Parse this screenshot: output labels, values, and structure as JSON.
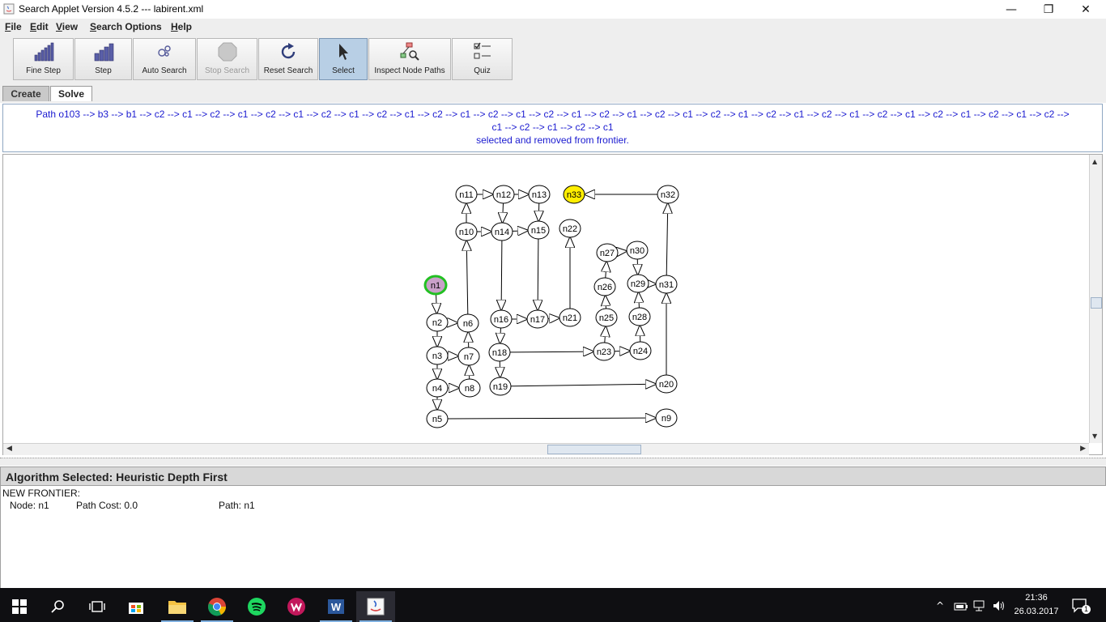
{
  "window": {
    "title": "Search Applet Version 4.5.2 --- labirent.xml",
    "minimize": "—",
    "maximize": "❐",
    "close": "✕"
  },
  "menu": {
    "items": [
      {
        "first": "F",
        "rest": "ile"
      },
      {
        "first": "E",
        "rest": "dit"
      },
      {
        "first": "V",
        "rest": "iew"
      },
      {
        "first": "S",
        "rest": "earch Options"
      },
      {
        "first": "H",
        "rest": "elp"
      }
    ]
  },
  "toolbar": {
    "buttons": [
      {
        "label": "Fine Step",
        "icon": "fine-step-icon"
      },
      {
        "label": "Step",
        "icon": "step-icon"
      },
      {
        "label": "Auto Search",
        "icon": "auto-search-icon"
      },
      {
        "label": "Stop Search",
        "icon": "stop-icon"
      },
      {
        "label": "Reset Search",
        "icon": "reset-icon"
      },
      {
        "label": "Select",
        "icon": "cursor-icon"
      },
      {
        "label": "Inspect Node Paths",
        "icon": "inspect-icon"
      },
      {
        "label": "Quiz",
        "icon": "quiz-icon"
      }
    ]
  },
  "tabs": {
    "create": "Create",
    "solve": "Solve"
  },
  "message": {
    "line1": "Path o103 --> b3 --> b1 --> c2 --> c1 --> c2 --> c1 --> c2 --> c1 --> c2 --> c1 --> c2 --> c1 --> c2 --> c1 --> c2 --> c1 --> c2 --> c1 --> c2 --> c1 --> c2 --> c1 --> c2 --> c1 --> c2 --> c1 --> c2 --> c1 --> c2 --> c1 --> c2 --> c1 --> c2 --> c1 --> c2 -->",
    "line2": "c1 --> c2 --> c1 --> c2 --> c1",
    "line3": "selected and removed from frontier."
  },
  "graph": {
    "colors": {
      "start_fill": "#c9a0c9",
      "start_border": "#22c022",
      "goal_fill": "#ffee00",
      "node_fill": "#ffffff"
    },
    "nodes": [
      "n1",
      "n2",
      "n3",
      "n4",
      "n5",
      "n6",
      "n7",
      "n8",
      "n9",
      "n10",
      "n11",
      "n12",
      "n13",
      "n14",
      "n15",
      "n16",
      "n17",
      "n18",
      "n19",
      "n20",
      "n21",
      "n22",
      "n23",
      "n24",
      "n25",
      "n26",
      "n27",
      "n28",
      "n29",
      "n30",
      "n31",
      "n32",
      "n33"
    ],
    "start": "n1",
    "goal": "n33"
  },
  "algorithm": {
    "header": "Algorithm Selected: Heuristic Depth First",
    "frontier_label": "NEW FRONTIER:",
    "node": "Node: n1",
    "cost": "Path Cost: 0.0",
    "path": "Path: n1"
  },
  "taskbar": {
    "apps": [
      "windows-start-icon",
      "search-icon",
      "task-view-icon",
      "store-icon",
      "file-explorer-icon",
      "chrome-icon",
      "spotify-icon",
      "wondershare-icon",
      "word-icon",
      "java-icon"
    ],
    "time": "21:36",
    "date": "26.03.2017",
    "notifications": "1"
  }
}
